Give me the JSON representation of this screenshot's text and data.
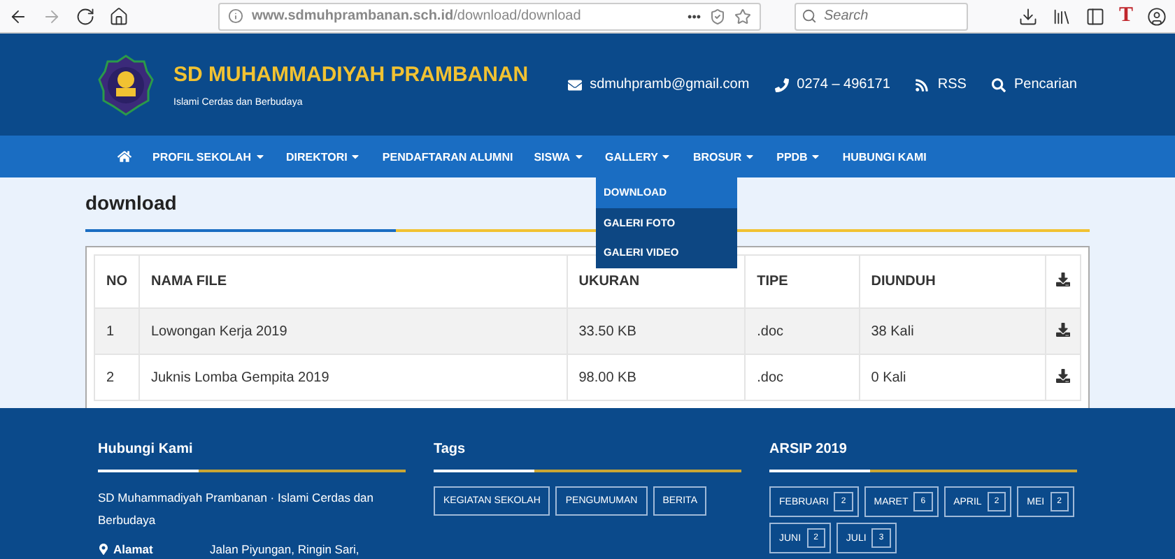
{
  "browser": {
    "url": "**www.sdmuhprambanan.sch.id**/download/download",
    "more": "•••",
    "search": {
      "placeholder": "Search"
    },
    "extension_letter": "T"
  },
  "header": {
    "title": "SD MUHAMMADIYAH PRAMBANAN",
    "tagline": "Islami Cerdas dan Berbudaya",
    "contacts": [
      {
        "kind": "email",
        "text": "sdmuhpramb@gmail.com"
      },
      {
        "kind": "phone",
        "text": "0274 – 496171"
      },
      {
        "kind": "rss",
        "text": "RSS"
      },
      {
        "kind": "search",
        "text": "Pencarian"
      }
    ]
  },
  "nav": {
    "items": [
      {
        "label": "PROFIL SEKOLAH",
        "has_menu": true
      },
      {
        "label": "DIREKTORI",
        "has_menu": true
      },
      {
        "label": "PENDAFTARAN ALUMNI",
        "has_menu": false
      },
      {
        "label": "SISWA",
        "has_menu": true
      },
      {
        "label": "GALLERY",
        "has_menu": true,
        "submenu": [
          {
            "label": "DOWNLOAD",
            "selected": true
          },
          {
            "label": "GALERI FOTO",
            "selected": false
          },
          {
            "label": "GALERI VIDEO",
            "selected": false
          }
        ]
      },
      {
        "label": "BROSUR",
        "has_menu": true
      },
      {
        "label": "PPDB",
        "has_menu": true
      },
      {
        "label": "HUBUNGI KAMI",
        "has_menu": false
      }
    ]
  },
  "page": {
    "title": "download"
  },
  "table": {
    "columns": [
      "NO",
      "NAMA FILE",
      "UKURAN",
      "TIPE",
      "DIUNDUH"
    ],
    "rows": [
      {
        "cells": [
          "1",
          "Lowongan Kerja 2019",
          "33.50 KB",
          ".doc",
          "38 Kali"
        ]
      },
      {
        "cells": [
          "2",
          "Juknis Lomba Gempita 2019",
          "98.00 KB",
          ".doc",
          "0 Kali"
        ]
      }
    ]
  },
  "footer": {
    "contact": {
      "title": "Hubungi Kami",
      "text": "SD Muhammadiyah Prambanan · Islami Cerdas dan Berbudaya",
      "address_label": "Alamat",
      "address": "Jalan Piyungan, Ringin Sari,"
    },
    "tags": {
      "title": "Tags",
      "items": [
        "KEGIATAN SEKOLAH",
        "PENGUMUMAN",
        "BERITA"
      ]
    },
    "archive": {
      "title": "ARSIP 2019",
      "months": [
        {
          "name": "FEBRUARI",
          "count": "2"
        },
        {
          "name": "MARET",
          "count": "6"
        },
        {
          "name": "APRIL",
          "count": "2"
        },
        {
          "name": "MEI",
          "count": "2"
        },
        {
          "name": "JUNI",
          "count": "2"
        },
        {
          "name": "JULI",
          "count": "3"
        }
      ]
    }
  }
}
